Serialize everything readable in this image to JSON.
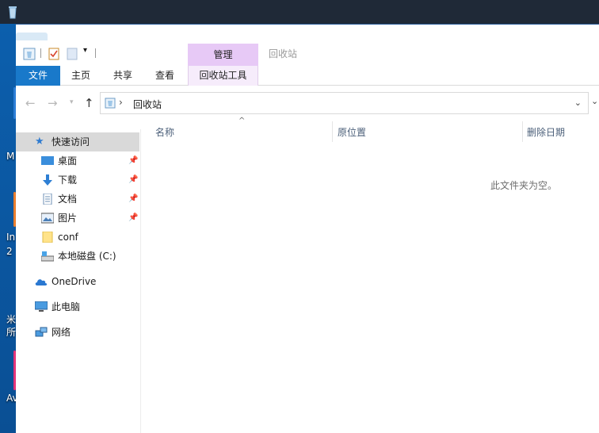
{
  "desktop": {
    "labels": [
      "M",
      "In",
      "2",
      "米",
      "所",
      "Av"
    ]
  },
  "window": {
    "title": "回收站",
    "context_tab": "管理",
    "ribbon_tabs": [
      "文件",
      "主页",
      "共享",
      "查看",
      "回收站工具"
    ]
  },
  "address": {
    "location": "回收站"
  },
  "nav": {
    "quick_access": "快速访问",
    "items": [
      {
        "label": "桌面",
        "icon": "desktop-icon"
      },
      {
        "label": "下载",
        "icon": "download-icon"
      },
      {
        "label": "文档",
        "icon": "document-icon"
      },
      {
        "label": "图片",
        "icon": "pictures-icon"
      },
      {
        "label": "conf",
        "icon": "folder-icon"
      },
      {
        "label": "本地磁盘 (C:)",
        "icon": "drive-icon"
      }
    ],
    "onedrive": "OneDrive",
    "this_pc": "此电脑",
    "network": "网络"
  },
  "columns": [
    "名称",
    "原位置",
    "删除日期"
  ],
  "empty_message": "此文件夹为空。"
}
